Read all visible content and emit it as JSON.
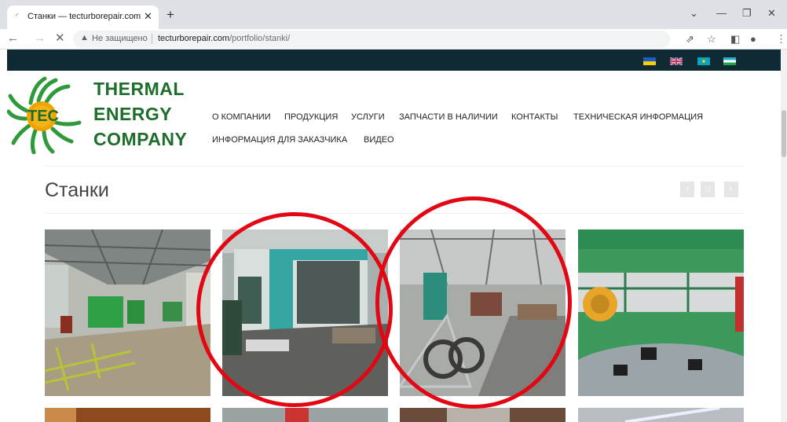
{
  "browser": {
    "tab_title": "Станки — tecturborepair.com",
    "tab_close": "✕",
    "new_tab": "+",
    "not_secure_label": "Не защищено",
    "url_host": "tecturborepair.com",
    "url_path": "/portfolio/stanki/",
    "nav_icons": {
      "back": "arrow-left-icon",
      "forward": "arrow-right-icon",
      "stop": "close-icon"
    }
  },
  "site": {
    "logo_lines": [
      "THERMAL",
      "ENERGY",
      "COMPANY"
    ],
    "logo_badge": "TEC",
    "nav_items": [
      "О КОМПАНИИ",
      "ПРОДУКЦИЯ",
      "УСЛУГИ",
      "ЗАПЧАСТИ В НАЛИЧИИ",
      "КОНТАКТЫ",
      "ТЕХНИЧЕСКАЯ ИНФОРМАЦИЯ",
      "ИНФОРМАЦИЯ ДЛЯ ЗАКАЗЧИКА",
      "ВИДЕО"
    ],
    "language_flags": [
      "ukraine-flag-icon",
      "uk-flag-icon",
      "kazakhstan-flag-icon",
      "uzbekistan-flag-icon"
    ],
    "page_title": "Станки",
    "pager": {
      "prev": "‹",
      "grid": "⁝⁝",
      "next": "›"
    }
  },
  "gallery": {
    "tiles": [
      "machine-shop-photo-1",
      "machine-shop-photo-2",
      "machine-shop-photo-3",
      "machine-shop-photo-4",
      "machine-shop-photo-5",
      "machine-shop-photo-6",
      "machine-shop-photo-7",
      "machine-shop-photo-8"
    ],
    "highlight_color": "#e30613"
  },
  "colors": {
    "brand_green": "#1c6e2a",
    "top_bar": "#0f2a33"
  }
}
